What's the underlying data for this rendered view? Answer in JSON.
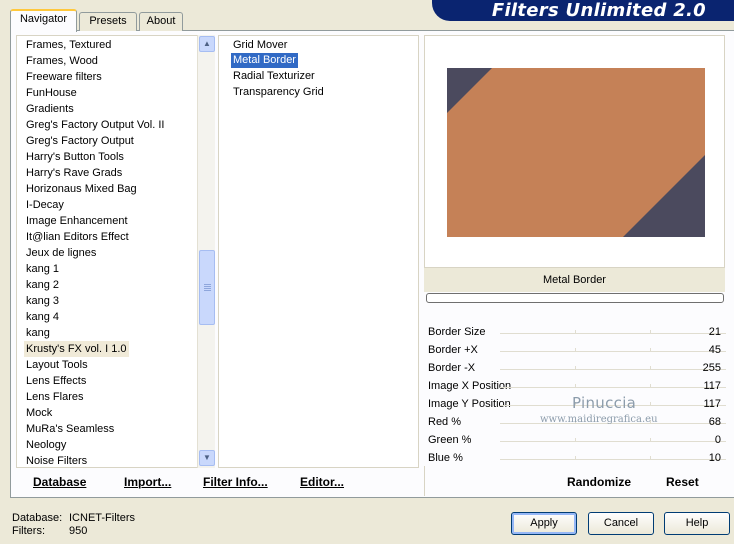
{
  "app": {
    "title": "Filters Unlimited 2.0"
  },
  "tabs": [
    {
      "label": "Navigator",
      "active": true
    },
    {
      "label": "Presets",
      "active": false
    },
    {
      "label": "About",
      "active": false
    }
  ],
  "categories": [
    "Frames, Textured",
    "Frames, Wood",
    "Freeware filters",
    "FunHouse",
    "Gradients",
    "Greg's Factory Output Vol. II",
    "Greg's Factory Output",
    "Harry's Button Tools",
    "Harry's Rave Grads",
    "Horizonaus Mixed Bag",
    "I-Decay",
    "Image Enhancement",
    "It@lian Editors Effect",
    "Jeux de lignes",
    "kang 1",
    "kang 2",
    "kang 3",
    "kang 4",
    "kang",
    "Krusty's FX vol. I 1.0",
    "Layout Tools",
    "Lens Effects",
    "Lens Flares",
    "Mock",
    "MuRa's Seamless",
    "Neology",
    "Noise Filters"
  ],
  "selected_category": "Krusty's FX vol. I 1.0",
  "filters": [
    "Grid Mover",
    "Metal Border",
    "Radial Texturizer",
    "Transparency Grid"
  ],
  "selected_filter": "Metal Border",
  "preview": {
    "main_color": "#c58157",
    "border_color": "#4b4a5e"
  },
  "filter_name": "Metal Border",
  "params": [
    {
      "label": "Border Size",
      "value": "21"
    },
    {
      "label": "Border +X",
      "value": "45"
    },
    {
      "label": "Border -X",
      "value": "255"
    },
    {
      "label": "Image X Position",
      "value": "117"
    },
    {
      "label": "Image Y Position",
      "value": "117"
    },
    {
      "label": "Red %",
      "value": "68"
    },
    {
      "label": "Green %",
      "value": "0"
    },
    {
      "label": "Blue %",
      "value": "10"
    }
  ],
  "watermark": {
    "name": "Pinuccia",
    "url": "www.maidiregrafica.eu"
  },
  "panel_buttons": {
    "database": "Database",
    "import": "Import...",
    "filter_info": "Filter Info...",
    "editor": "Editor...",
    "randomize": "Randomize",
    "reset": "Reset"
  },
  "status": {
    "database_label": "Database:",
    "database_value": "ICNET-Filters",
    "filters_label": "Filters:",
    "filters_value": "950"
  },
  "dialog_buttons": {
    "apply": "Apply",
    "cancel": "Cancel",
    "help": "Help"
  }
}
